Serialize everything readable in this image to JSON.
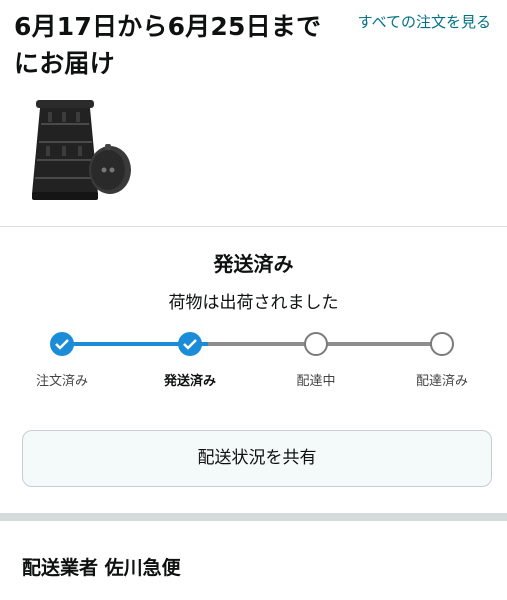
{
  "header": {
    "delivery_title": "6月17日から6月25日までにお届け",
    "view_all_link": "すべての注文を見る"
  },
  "product": {
    "image_icon": "folding-stool-image"
  },
  "status": {
    "title": "発送済み",
    "subtitle": "荷物は出荷されました",
    "progress_fraction": 0.333,
    "steps": [
      {
        "label": "注文済み",
        "state": "done"
      },
      {
        "label": "発送済み",
        "state": "done"
      },
      {
        "label": "配達中",
        "state": "todo"
      },
      {
        "label": "配達済み",
        "state": "todo"
      }
    ]
  },
  "share": {
    "label": "配送状況を共有"
  },
  "carrier": {
    "label": "配送業者 佐川急便"
  },
  "colors": {
    "accent": "#1a8cd8",
    "link": "#007185"
  }
}
